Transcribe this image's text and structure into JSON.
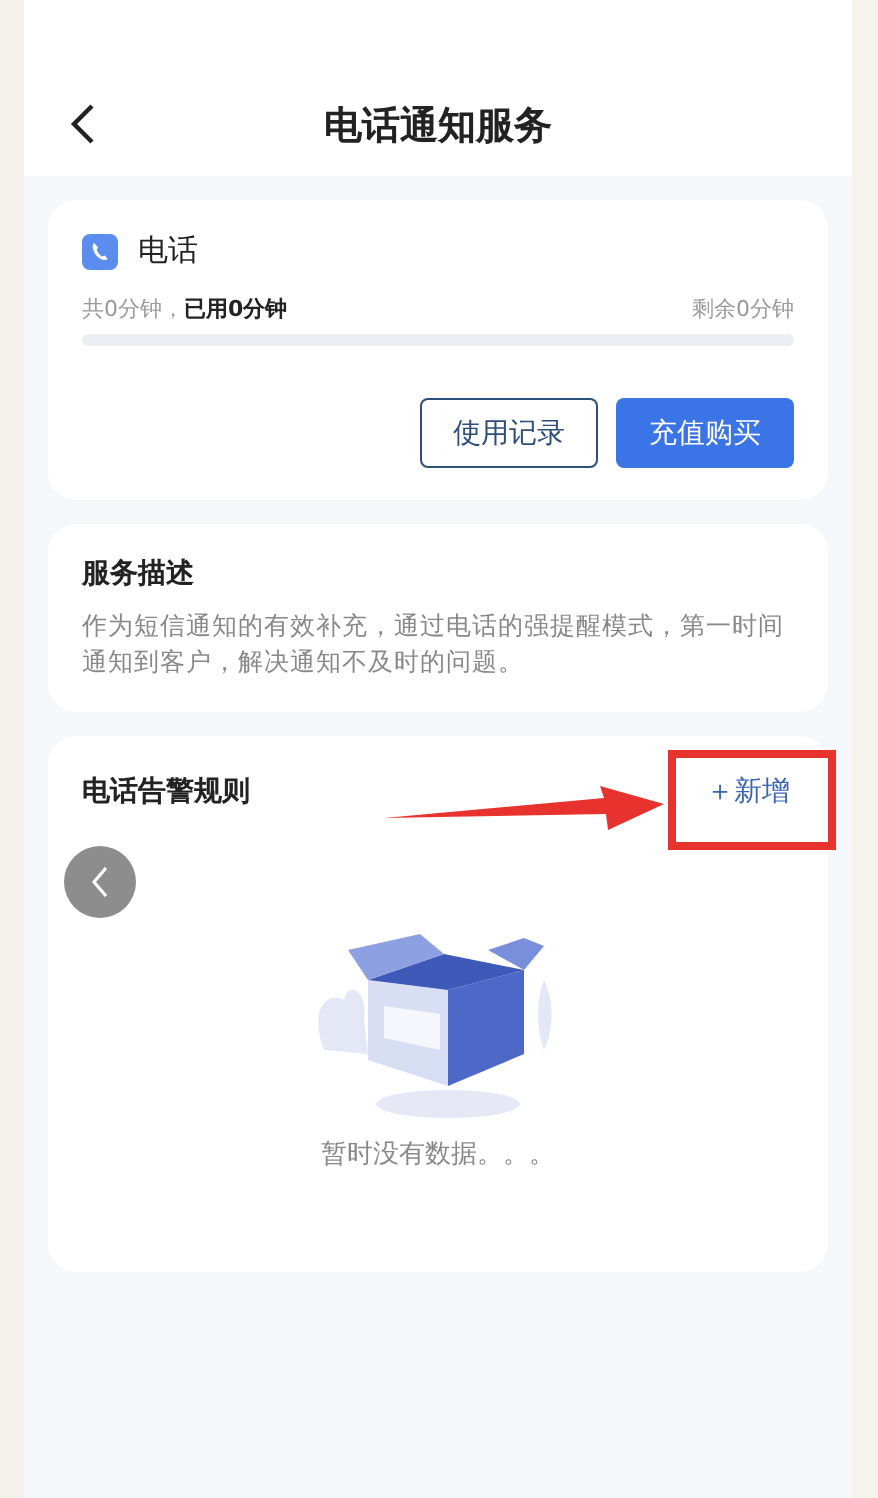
{
  "header": {
    "title": "电话通知服务"
  },
  "phone_card": {
    "title": "电话",
    "usage": "共0分钟，**已用0分钟**",
    "remaining": "剩余0分钟",
    "level": 0,
    "buttons": [
      {
        "label": "使用记录",
        "kind": "outline"
      },
      {
        "label": "充值购买",
        "kind": "primary"
      }
    ]
  },
  "description": {
    "title": "服务描述",
    "text": "作为短信通知的有效补充，通过电话的强提醒模式，第一时间通知到客户，解决通知不及时的问题。"
  },
  "rules": {
    "title": "电话告警规则",
    "add_label": "＋新增",
    "empty_text": "暂时没有数据。。。"
  }
}
